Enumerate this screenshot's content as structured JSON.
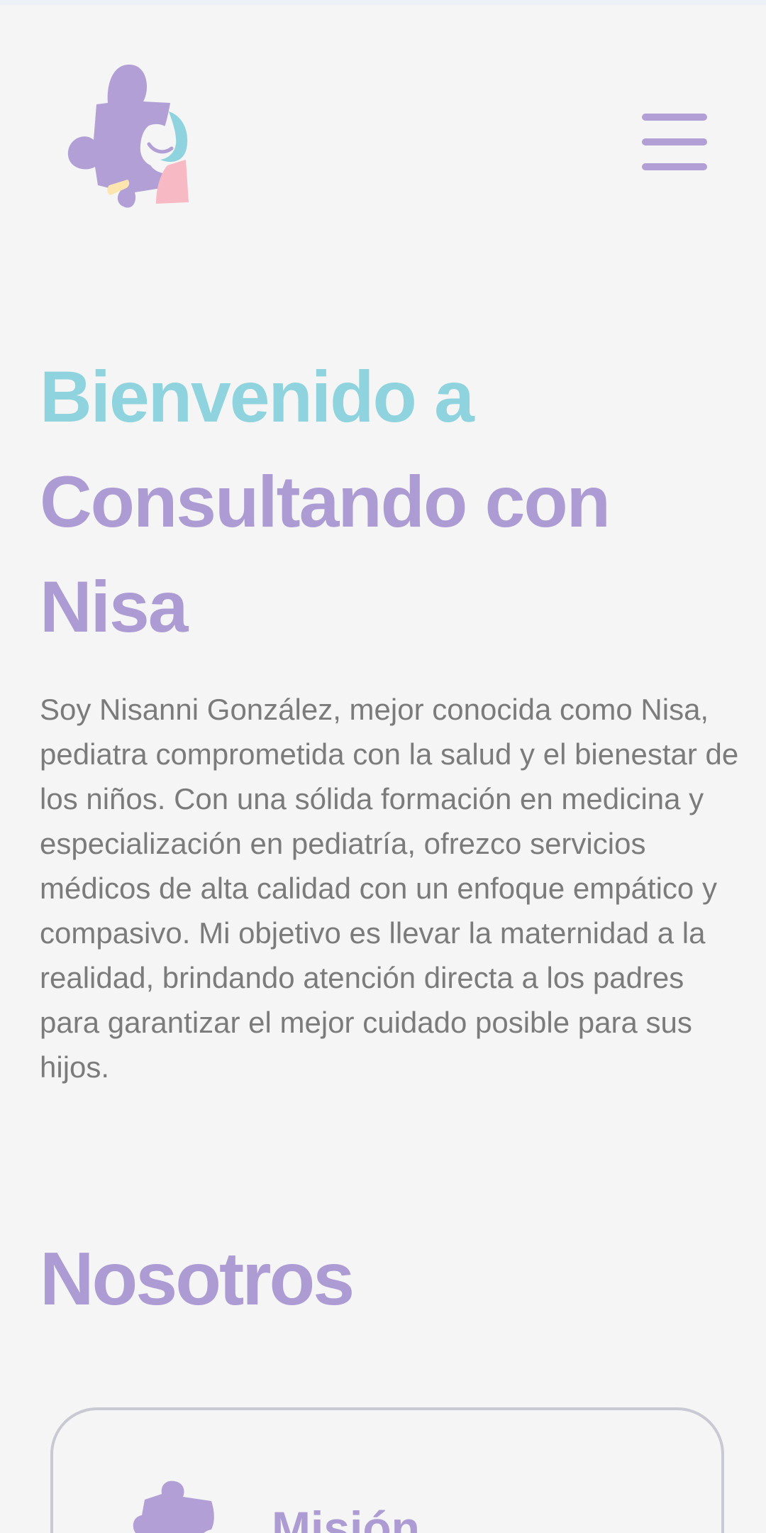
{
  "header": {
    "logo_name": "puzzle-mother-baby-logo",
    "menu_icon": "hamburger-menu-icon"
  },
  "hero": {
    "title_accent": "Bienvenido a",
    "title_rest": "Consultando con Nisa",
    "intro": "Soy Nisanni González, mejor conocida como Nisa, pediatra comprometida con la salud y el bienestar de los niños. Con una sólida formación en medicina y especialización en pediatría, ofrezco servicios médicos de alta calidad con un enfoque empático y compasivo. Mi objetivo es llevar la maternidad a la realidad, brindando atención directa a los padres para garantizar el mejor cuidado posible para sus hijos."
  },
  "about": {
    "title": "Nosotros",
    "cards": [
      {
        "icon": "puzzle-icon",
        "title": "Misión"
      }
    ]
  },
  "colors": {
    "primary": "#ad9bd4",
    "accent": "#8ed3dd",
    "pink": "#f7b9c3",
    "yellow": "#fde5b0",
    "text": "#7b7b7b",
    "background": "#f5f5f5"
  }
}
